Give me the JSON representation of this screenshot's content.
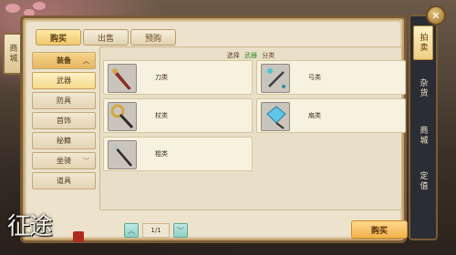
{
  "left_tab": {
    "label": "商城"
  },
  "top_tabs": [
    {
      "label": "购买",
      "active": true
    },
    {
      "label": "出售",
      "active": false
    },
    {
      "label": "预购",
      "active": false
    }
  ],
  "categories": [
    {
      "label": "装备",
      "type": "parent",
      "chevron": "︿"
    },
    {
      "label": "武器",
      "type": "selected"
    },
    {
      "label": "防具",
      "type": "normal"
    },
    {
      "label": "首饰",
      "type": "normal"
    },
    {
      "label": "秘籍",
      "type": "normal"
    },
    {
      "label": "坐骑",
      "type": "parent-collapsed",
      "chevron": "﹀"
    },
    {
      "label": "道具",
      "type": "normal"
    }
  ],
  "content": {
    "title_prefix": "选择",
    "title_highlight": "武器",
    "title_suffix": "分类",
    "items": [
      {
        "name": "刀类",
        "icon": "saber-icon"
      },
      {
        "name": "弓类",
        "icon": "bow-icon"
      },
      {
        "name": "杖类",
        "icon": "staff-icon"
      },
      {
        "name": "扇类",
        "icon": "fan-icon"
      },
      {
        "name": "棍类",
        "icon": "club-icon"
      }
    ]
  },
  "pager": {
    "prev": "︿",
    "page": "1/1",
    "next": "﹀"
  },
  "buy_button": {
    "label": "购买"
  },
  "right_panel": [
    {
      "label": "拍卖",
      "active": true
    },
    {
      "label": "杂货",
      "active": false
    },
    {
      "label": "商城",
      "active": false
    },
    {
      "label": "定值",
      "active": false
    }
  ],
  "close": {
    "glyph": "✕"
  },
  "logo": {
    "text": "征途"
  }
}
